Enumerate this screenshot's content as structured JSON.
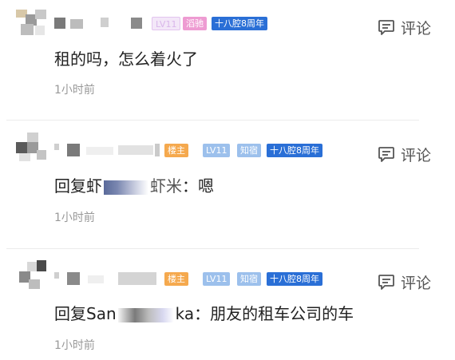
{
  "comments": [
    {
      "badges": [
        {
          "text": "LV11",
          "style": "faded-lavender"
        },
        {
          "text": "滔驰",
          "style": "pink"
        },
        {
          "text": "十八腔8周年",
          "style": "blue-solid"
        }
      ],
      "body": "租的吗，怎么着火了",
      "time": "1小时前",
      "reply_label": "评论"
    },
    {
      "badges": [
        {
          "text": "楼主",
          "style": "orange"
        },
        {
          "text": "LV11",
          "style": "light-blue"
        },
        {
          "text": "知宿",
          "style": "light-blue"
        },
        {
          "text": "十八腔8周年",
          "style": "blue-solid"
        }
      ],
      "body_prefix": "回复虾",
      "body_mid": "虾米",
      "body_suffix": "：嗯",
      "time": "1小时前",
      "reply_label": "评论"
    },
    {
      "badges": [
        {
          "text": "楼主",
          "style": "orange"
        },
        {
          "text": "LV11",
          "style": "light-blue"
        },
        {
          "text": "知宿",
          "style": "light-blue"
        },
        {
          "text": "十八腔8周年",
          "style": "blue-solid"
        }
      ],
      "body_prefix": "回复San",
      "body_suffix": "ka：朋友的租车公司的车",
      "time": "1小时前",
      "reply_label": "评论"
    }
  ],
  "colors": {
    "badge_blue": "#2a6fd6",
    "badge_orange": "#f5a94e",
    "badge_light_blue": "#9cc0ec",
    "badge_pink": "#ee9bd2",
    "badge_lavender": "#e2c4ef",
    "icon": "comment-bubble-icon"
  }
}
